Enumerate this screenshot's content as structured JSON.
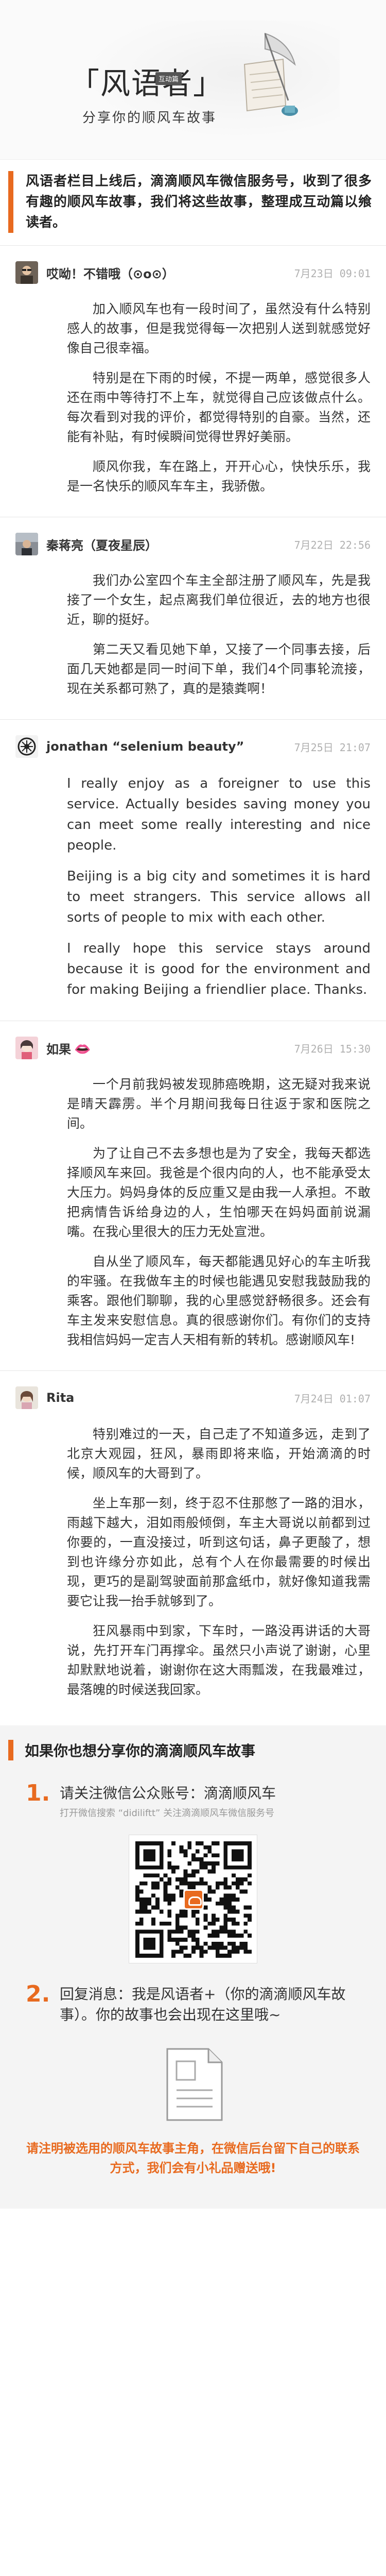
{
  "banner": {
    "title": "「风语者」",
    "tag": "互动篇",
    "subtitle": "分享你的顺风车故事"
  },
  "intro": {
    "text": "风语者栏目上线后，滴滴顺风车微信服务号，收到了很多有趣的顺风车故事，我们将这些故事，整理成互动篇以飨读者。"
  },
  "comments": [
    {
      "name": "哎呦！不错哦（⊙o⊙）",
      "date": "7月23日 09:01",
      "paragraphs": [
        "加入顺风车也有一段时间了，虽然没有什么特别感人的故事，但是我觉得每一次把别人送到就感觉好像自己很幸福。",
        "特别是在下雨的时候，不提一两单，感觉很多人还在雨中等待打不上车，就觉得自己应该做点什么。每次看到对我的评价，都觉得特别的自豪。当然，还能有补贴，有时候瞬间觉得世界好美丽。",
        "顺风你我，车在路上，开开心心，快快乐乐，我是一名快乐的顺风车车主，我骄傲。"
      ]
    },
    {
      "name": "秦蒋亮（夏夜星辰）",
      "date": "7月22日 22:56",
      "paragraphs": [
        "我们办公室四个车主全部注册了顺风车，先是我接了一个女生，起点离我们单位很近，去的地方也很近，聊的挺好。",
        "第二天又看见她下单，又接了一个同事去接，后面几天她都是同一时间下单，我们4个同事轮流接，现在关系都可熟了，真的是猿粪啊！"
      ]
    },
    {
      "name": "jonathan “selenium beauty”",
      "date": "7月25日 21:07",
      "paragraphs": [
        "I really enjoy as a foreigner to use this service. Actually besides saving money you can meet some really interesting and nice people.",
        "Beijing is a big city and sometimes it is hard to meet strangers. This service allows all sorts of people to mix with each other.",
        "I really hope this service stays around because it is good for the environment and for making Beijing a friendlier place. Thanks."
      ]
    },
    {
      "name": "如果",
      "date": "7月26日 15:30",
      "paragraphs": [
        "一个月前我妈被发现肺癌晚期，这无疑对我来说是晴天霹雳。半个月期间我每日往返于家和医院之间。",
        "为了让自己不去多想也是为了安全，我每天都选择顺风车来回。我爸是个很内向的人，也不能承受太大压力。妈妈身体的反应重又是由我一人承担。不敢把病情告诉给身边的人，生怕哪天在妈妈面前说漏嘴。在我心里很大的压力无处宣泄。",
        "自从坐了顺风车，每天都能遇见好心的车主听我的牢骚。在我做车主的时候也能遇见安慰我鼓励我的乘客。跟他们聊聊，我的心里感觉舒畅很多。还会有车主发来安慰信息。真的很感谢你们。有你们的支持我相信妈妈一定吉人天相有新的转机。感谢顺风车!"
      ]
    },
    {
      "name": "Rita",
      "date": "7月24日 01:07",
      "paragraphs": [
        "特别难过的一天，自己走了不知道多远，走到了北京大观园，狂风，暴雨即将来临，开始滴滴的时候，顺风车的大哥到了。",
        "坐上车那一刻，终于忍不住那憋了一路的泪水，雨越下越大，泪如雨般倾倒，车主大哥说以前都到过你要的，一直没接过，听到这句话，鼻子更酸了，想到也许缘分亦如此，总有个人在你最需要的时候出现，更巧的是副驾驶面前那盒纸巾，就好像知道我需要它让我一抬手就够到了。",
        "狂风暴雨中到家，下车时，一路没再讲话的大哥说，先打开车门再撑伞。虽然只小声说了谢谢，心里却默默地说着，谢谢你在这大雨瓢泼，在我最难过，最落魄的时候送我回家。"
      ]
    }
  ],
  "share": {
    "title": "如果你也想分享你的滴滴顺风车故事",
    "step1_num": "1",
    "step1_main": "请关注微信公众账号：滴滴顺风车",
    "step1_sub": "打开微信搜索 “didiliftt” 关注滴滴顺风车微信服务号",
    "step2_num": "2",
    "step2_main": "回复消息：我是风语者+（你的滴滴顺风车故事）。你的故事也会出现在这里哦~",
    "footer": "请注明被选用的顺风车故事主角，在微信后台留下自己的联系方式，我们会有小礼品赠送哦!"
  },
  "colors": {
    "accent": "#e86a1f"
  }
}
